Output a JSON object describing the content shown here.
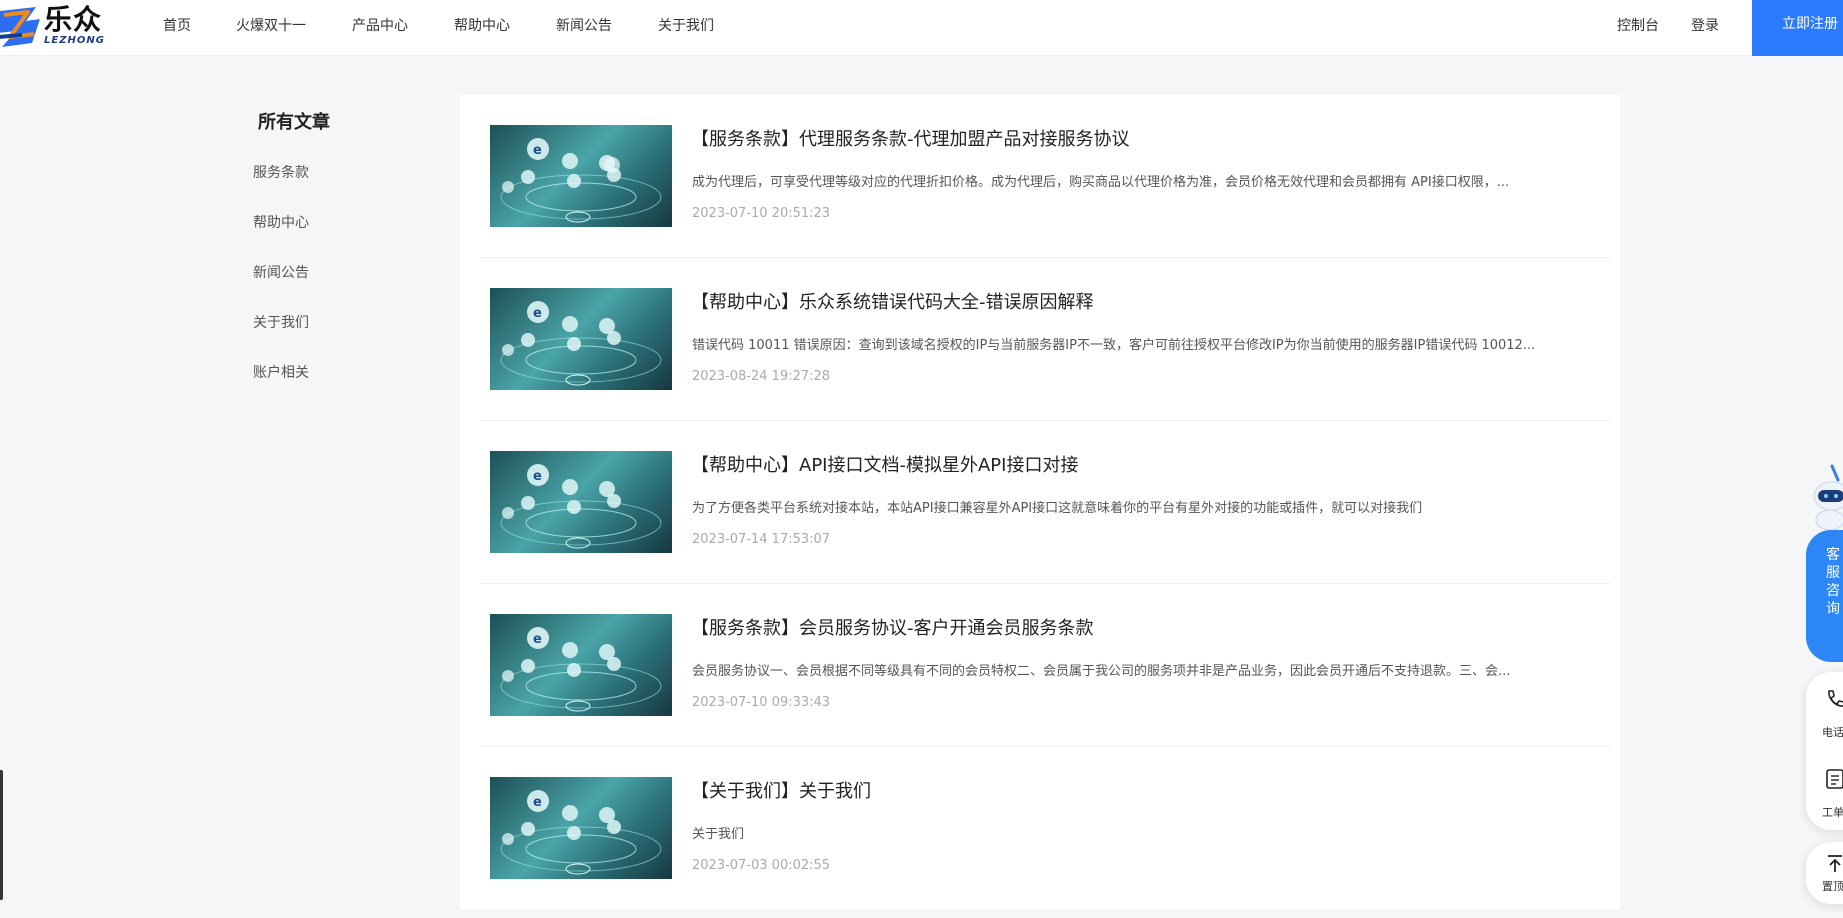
{
  "brand": {
    "name_cn": "乐众",
    "name_en": "LEZHONG",
    "accent": "#2c7bff"
  },
  "nav": {
    "items": [
      "首页",
      "火爆双十一",
      "产品中心",
      "帮助中心",
      "新闻公告",
      "关于我们"
    ]
  },
  "header_right": {
    "console": "控制台",
    "login": "登录",
    "register": "立即注册"
  },
  "sidebar": {
    "title": "所有文章",
    "items": [
      "服务条款",
      "帮助中心",
      "新闻公告",
      "关于我们",
      "账户相关"
    ]
  },
  "articles": [
    {
      "title": "【服务条款】代理服务条款-代理加盟产品对接服务协议",
      "desc": "成为代理后，可享受代理等级对应的代理折扣价格。成为代理后，购买商品以代理价格为准，会员价格无效代理和会员都拥有 API接口权限，...",
      "date": "2023-07-10 20:51:23"
    },
    {
      "title": "【帮助中心】乐众系统错误代码大全-错误原因解释",
      "desc": "错误代码 10011 错误原因：查询到该域名授权的IP与当前服务器IP不一致，客户可前往授权平台修改IP为你当前使用的服务器IP错误代码 10012...",
      "date": "2023-08-24 19:27:28"
    },
    {
      "title": "【帮助中心】API接口文档-模拟星外API接口对接",
      "desc": "为了方便各类平台系统对接本站，本站API接口兼容星外API接口这就意味着你的平台有星外对接的功能或插件，就可以对接我们",
      "date": "2023-07-14 17:53:07"
    },
    {
      "title": "【服务条款】会员服务协议-客户开通会员服务条款",
      "desc": "会员服务协议一、会员根据不同等级具有不同的会员特权二、会员属于我公司的服务项并非是产品业务，因此会员开通后不支持退款。三、会...",
      "date": "2023-07-10 09:33:43"
    },
    {
      "title": "【关于我们】关于我们",
      "desc": "关于我们",
      "date": "2023-07-03 00:02:55"
    }
  ],
  "float_widget": {
    "cs_chars": [
      "客",
      "服",
      "咨",
      "询"
    ],
    "phone": "电话",
    "ticket": "工单",
    "top": "置顶"
  }
}
